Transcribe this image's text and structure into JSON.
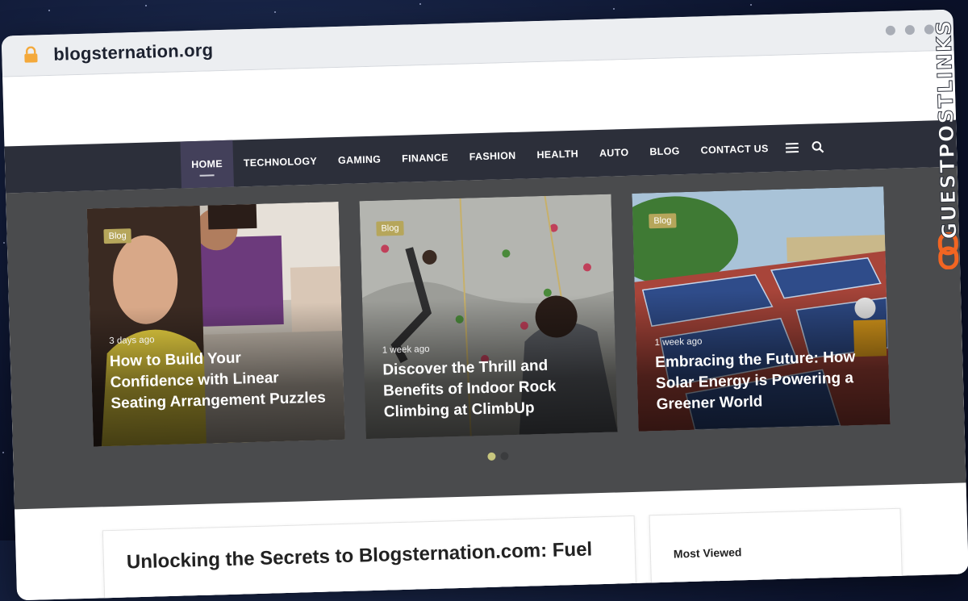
{
  "browser": {
    "url": "blogsternation.org"
  },
  "nav": {
    "items": [
      "HOME",
      "TECHNOLOGY",
      "GAMING",
      "FINANCE",
      "FASHION",
      "HEALTH",
      "AUTO",
      "BLOG",
      "CONTACT US"
    ],
    "menu_icon": "hamburger-icon",
    "search_icon": "search-icon"
  },
  "slides": [
    {
      "category": "Blog",
      "age": "3 days ago",
      "title": "How to Build Your Confidence with Linear Seating Arrangement Puzzles"
    },
    {
      "category": "Blog",
      "age": "1 week ago",
      "title": "Discover the Thrill and Benefits of Indoor Rock Climbing at ClimbUp"
    },
    {
      "category": "Blog",
      "age": "1 week ago",
      "title": "Embracing the Future: How Solar Energy is Powering a Greener World"
    }
  ],
  "pager": {
    "count": 2,
    "active": 1
  },
  "article": {
    "title": "Unlocking the Secrets to Blogsternation.com: Fuel"
  },
  "sidebar": {
    "title": "Most Viewed"
  },
  "watermark": {
    "text": "GUESTPOSTLINKS",
    "accent": "#f26522"
  },
  "colors": {
    "nav_bg": "#2c2f3a",
    "hero_bg": "#4a4b4d",
    "tag_bg": "#b6a65b",
    "lock": "#f4a93b"
  }
}
